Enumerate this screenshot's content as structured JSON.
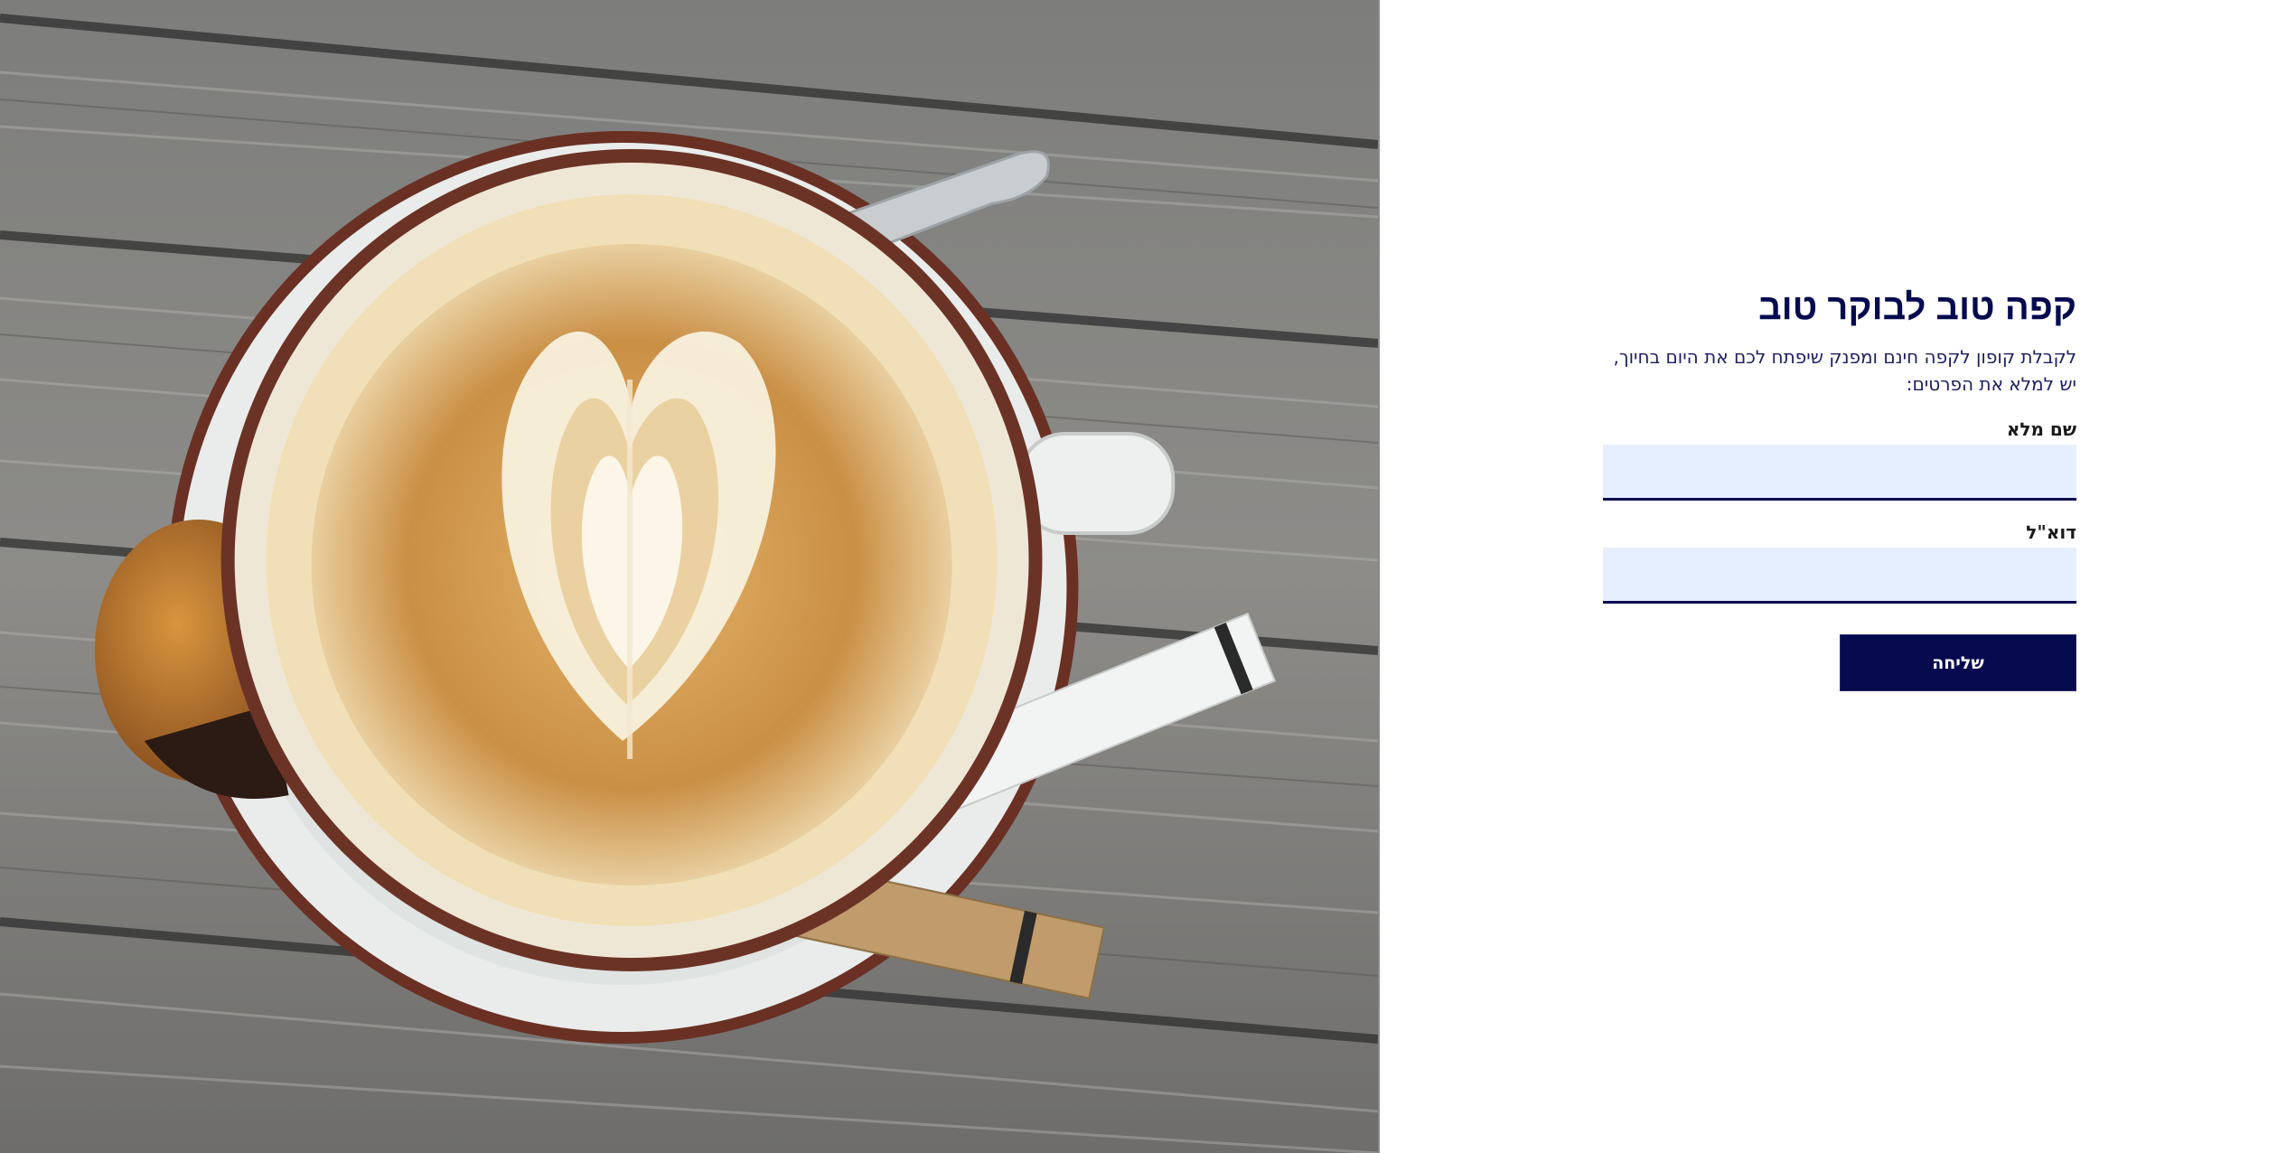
{
  "hero_image": {
    "subject": "latte-art-coffee-cup-on-wooden-table",
    "colors": {
      "wood_light": "#8f8f8f",
      "wood_dark": "#3e3e3e",
      "saucer": "#e7ebea",
      "cup_rim": "#6b3326",
      "crema": "#cf9a4f",
      "foam": "#f7efd9"
    }
  },
  "form": {
    "title": "קפה טוב לבוקר טוב",
    "subtitle": "לקבלת קופון לקפה חינם ומפנק שיפתח לכם את היום בחיוך, יש למלא את הפרטים:",
    "fields": [
      {
        "label": "שם מלא",
        "value": "",
        "placeholder": ""
      },
      {
        "label": "דוא\"ל",
        "value": "",
        "placeholder": ""
      }
    ],
    "submit_label": "שליחה"
  },
  "colors": {
    "brand_navy": "#060b4f",
    "field_bg": "#e6efff",
    "page_bg": "#ffffff"
  }
}
